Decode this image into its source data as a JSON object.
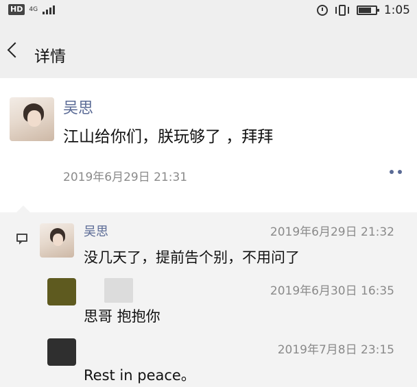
{
  "status_bar": {
    "hd_badge": "HD",
    "network": "4G",
    "time": "1:05"
  },
  "header": {
    "title": "详情"
  },
  "post": {
    "author": "吴思",
    "text": "江山给你们，朕玩够了 ，拜拜",
    "time": "2019年6月29日 21:31"
  },
  "comments": [
    {
      "author": "吴思",
      "time": "2019年6月29日 21:32",
      "text": "没几天了，提前告个别，不用问了"
    },
    {
      "author": "",
      "time": "2019年6月30日 16:35",
      "text": "思哥 抱抱你"
    },
    {
      "author": "",
      "time": "2019年7月8日 23:15",
      "text": "Rest in peace。"
    }
  ],
  "colors": {
    "link": "#5a6a95",
    "header_bg": "#efefef",
    "comments_bg": "#f3f3f3",
    "secondary_text": "#8a8a8a"
  }
}
